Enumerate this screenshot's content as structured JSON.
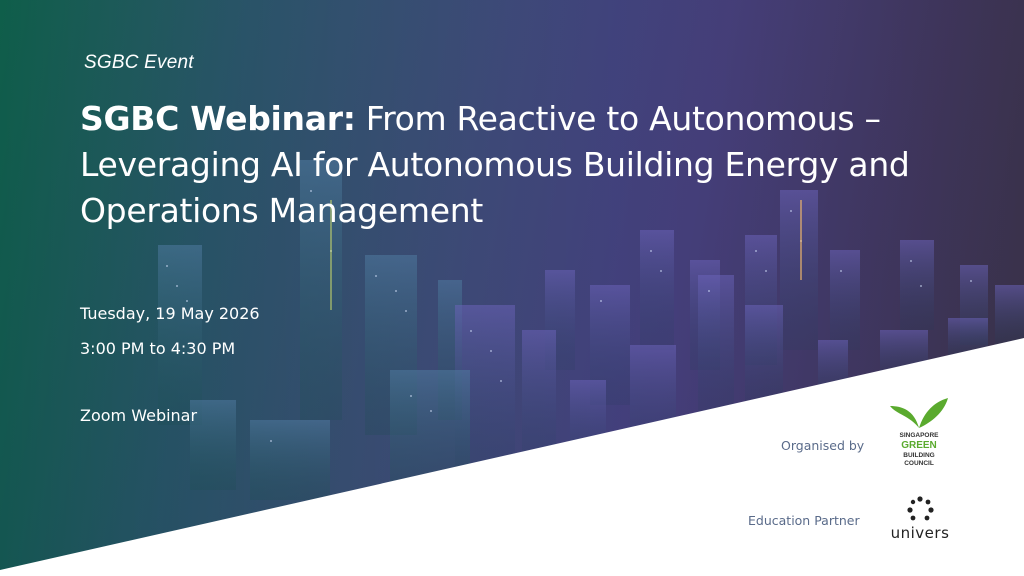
{
  "event": {
    "tag": "SGBC Event"
  },
  "title": {
    "bold_part": "SGBC Webinar:",
    "regular_part": " From Reactive to Autonomous – Leveraging AI for Autonomous Building Energy and Operations Management"
  },
  "details": {
    "date": "Tuesday, 19 May 2026",
    "time": "3:00 PM to 4:30 PM",
    "venue": "Zoom Webinar"
  },
  "partners": {
    "organised_by_label": "Organised by",
    "education_partner_label": "Education Partner",
    "sgbc_logo": {
      "line1": "SINGAPORE",
      "line2": "GREEN",
      "line3": "BUILDING",
      "line4": "COUNCIL"
    },
    "univers_logo": {
      "wordmark": "univers"
    }
  },
  "colors": {
    "brand_green": "#5aaa2e",
    "label_color": "#5a6b8a",
    "accent_purple": "#8f7bff"
  }
}
